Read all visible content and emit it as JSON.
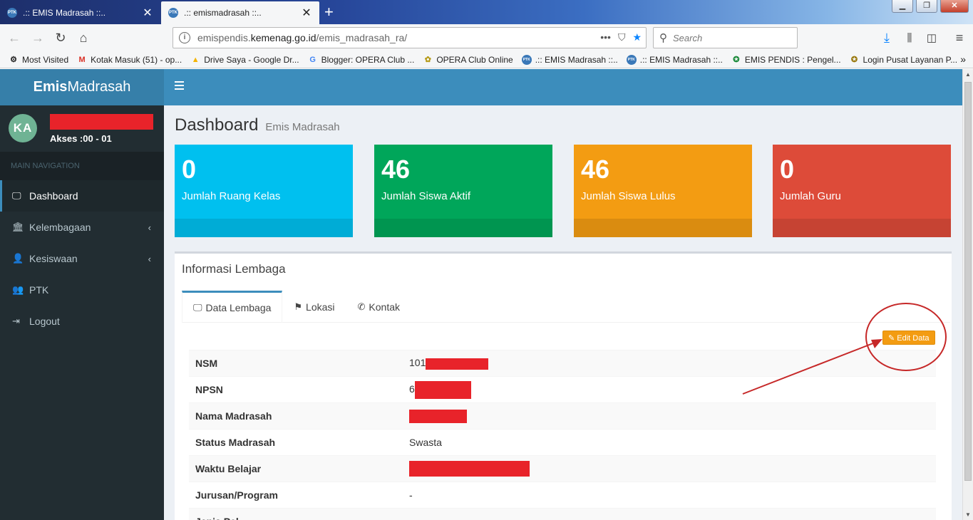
{
  "browser": {
    "tabs": [
      {
        "title": ".:: EMIS Madrasah ::..",
        "favicon": "PTK",
        "active": false
      },
      {
        "title": ".:: emismadrasah ::..",
        "favicon": "PTK",
        "active": true
      }
    ],
    "url_prefix": "emispendis.",
    "url_host": "kemenag.go.id",
    "url_path": "/emis_madrasah_ra/",
    "search_placeholder": "Search",
    "bookmarks": [
      {
        "label": "Most Visited",
        "icon": "gear-icon"
      },
      {
        "label": "Kotak Masuk (51) - op...",
        "icon": "gmail-icon"
      },
      {
        "label": "Drive Saya - Google Dr...",
        "icon": "drive-icon"
      },
      {
        "label": "Blogger: OPERA Club ...",
        "icon": "google-icon"
      },
      {
        "label": "OPERA Club Online",
        "icon": "opera-club-icon"
      },
      {
        "label": ".:: EMIS Madrasah ::..",
        "icon": "ptk-icon"
      },
      {
        "label": ".:: EMIS Madrasah ::..",
        "icon": "ptk-icon"
      },
      {
        "label": "EMIS PENDIS : Pengel...",
        "icon": "kemenag-icon"
      },
      {
        "label": "Login Pusat Layanan P...",
        "icon": "kemenag-icon"
      }
    ]
  },
  "app": {
    "brand_bold": "Emis",
    "brand_rest": "Madrasah",
    "user": {
      "initials": "KA",
      "akses": "Akses :00 - 01"
    },
    "nav_header": "MAIN NAVIGATION",
    "menu": [
      {
        "label": "Dashboard",
        "icon": "monitor-icon",
        "active": true,
        "has_children": false
      },
      {
        "label": "Kelembagaan",
        "icon": "bank-icon",
        "active": false,
        "has_children": true
      },
      {
        "label": "Kesiswaan",
        "icon": "user-icon",
        "active": false,
        "has_children": true
      },
      {
        "label": "PTK",
        "icon": "users-icon",
        "active": false,
        "has_children": false
      },
      {
        "label": "Logout",
        "icon": "sign-out-icon",
        "active": false,
        "has_children": false
      }
    ],
    "page_title": "Dashboard",
    "page_subtitle": "Emis Madrasah",
    "stats": [
      {
        "value": "0",
        "label": "Jumlah Ruang Kelas",
        "color": "#00c0ef"
      },
      {
        "value": "46",
        "label": "Jumlah Siswa Aktif",
        "color": "#00a65a"
      },
      {
        "value": "46",
        "label": "Jumlah Siswa Lulus",
        "color": "#f39c12"
      },
      {
        "value": "0",
        "label": "Jumlah Guru",
        "color": "#dd4b39"
      }
    ],
    "panel_title": "Informasi Lembaga",
    "tabs": [
      {
        "label": "Data Lembaga",
        "icon": "monitor-icon",
        "active": true
      },
      {
        "label": "Lokasi",
        "icon": "signpost-icon",
        "active": false
      },
      {
        "label": "Kontak",
        "icon": "phone-icon",
        "active": false
      }
    ],
    "edit_button": "Edit Data",
    "table": [
      {
        "key": "NSM",
        "value": "101"
      },
      {
        "key": "NPSN",
        "value": "6"
      },
      {
        "key": "Nama Madrasah",
        "value": ""
      },
      {
        "key": "Status Madrasah",
        "value": "Swasta"
      },
      {
        "key": "Waktu Belajar",
        "value": ""
      },
      {
        "key": "Jurusan/Program",
        "value": "-"
      },
      {
        "key": "Jenis Pel...",
        "value": ""
      }
    ]
  },
  "colors": {
    "accent": "#3c8dbc",
    "sidebar": "#222d32",
    "redaction": "#e8232a",
    "annotation": "#c62828"
  }
}
